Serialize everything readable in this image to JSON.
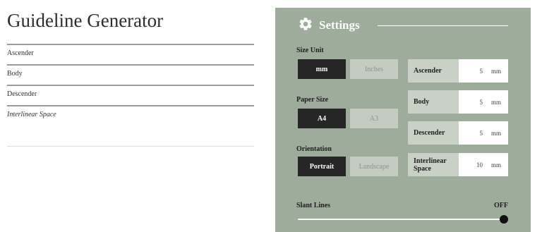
{
  "preview": {
    "title": "Guideline Generator",
    "lines": [
      "Ascender",
      "Body",
      "Descender",
      "Interlinear Space"
    ]
  },
  "settings": {
    "title": "Settings",
    "size_unit": {
      "label": "Size Unit",
      "options": [
        "mm",
        "Inches"
      ],
      "selected": "mm"
    },
    "paper_size": {
      "label": "Paper Size",
      "options": [
        "A4",
        "A3"
      ],
      "selected": "A4"
    },
    "orientation": {
      "label": "Orientation",
      "options": [
        "Portrait",
        "Landscape"
      ],
      "selected": "Portrait"
    },
    "fields": [
      {
        "label": "Ascender",
        "value": "5",
        "unit": "mm"
      },
      {
        "label": "Body",
        "value": "5",
        "unit": "mm"
      },
      {
        "label": "Descender",
        "value": "5",
        "unit": "mm"
      },
      {
        "label": "Interlinear Space",
        "value": "10",
        "unit": "mm"
      }
    ],
    "slant": {
      "label": "Slant Lines",
      "state": "OFF"
    }
  },
  "colors": {
    "panel": "#9eac9b",
    "selected": "#262626",
    "unselected": "#c4ccc2"
  }
}
